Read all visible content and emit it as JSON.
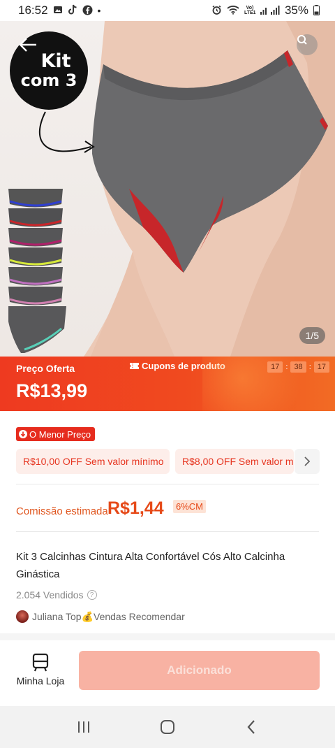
{
  "status_bar": {
    "time": "16:52",
    "signal_text": "Vo) LTE1",
    "battery": "35%",
    "icons": [
      "gallery-icon",
      "tiktok-icon",
      "facebook-icon",
      "dot-icon",
      "alarm-icon",
      "wifi-icon",
      "signal-icon",
      "battery-icon"
    ]
  },
  "hero": {
    "badge_line1": "Kit",
    "badge_line2": "com 3",
    "counter": "1/5"
  },
  "price_banner": {
    "offer_label": "Preço Oferta",
    "price": "R$13,99",
    "coupons_label": "Cupons de produto",
    "timer": [
      "17",
      "38",
      "17"
    ]
  },
  "deals": {
    "lowest_price_badge": "O Menor Preço",
    "coupons": [
      {
        "label": "R$10,00 OFF Sem valor mínimo"
      },
      {
        "label": "R$8,00 OFF Sem valor m"
      }
    ]
  },
  "commission": {
    "label": "Comissão estimada",
    "value": "R$1,44",
    "badge": "6%CM"
  },
  "product": {
    "title": "Kit 3 Calcinhas Cintura Alta Confortável Cós Alto Calcinha Ginástica",
    "sold": "2.054 Vendidos",
    "recommender": "Juliana Top💰Vendas Recomendar"
  },
  "actions": {
    "store_label": "Minha Loja",
    "add_label": "Adicionado"
  },
  "colors": {
    "accent": "#ee3a20",
    "commission": "#e64a19",
    "button_disabled": "#f8b2a3"
  }
}
